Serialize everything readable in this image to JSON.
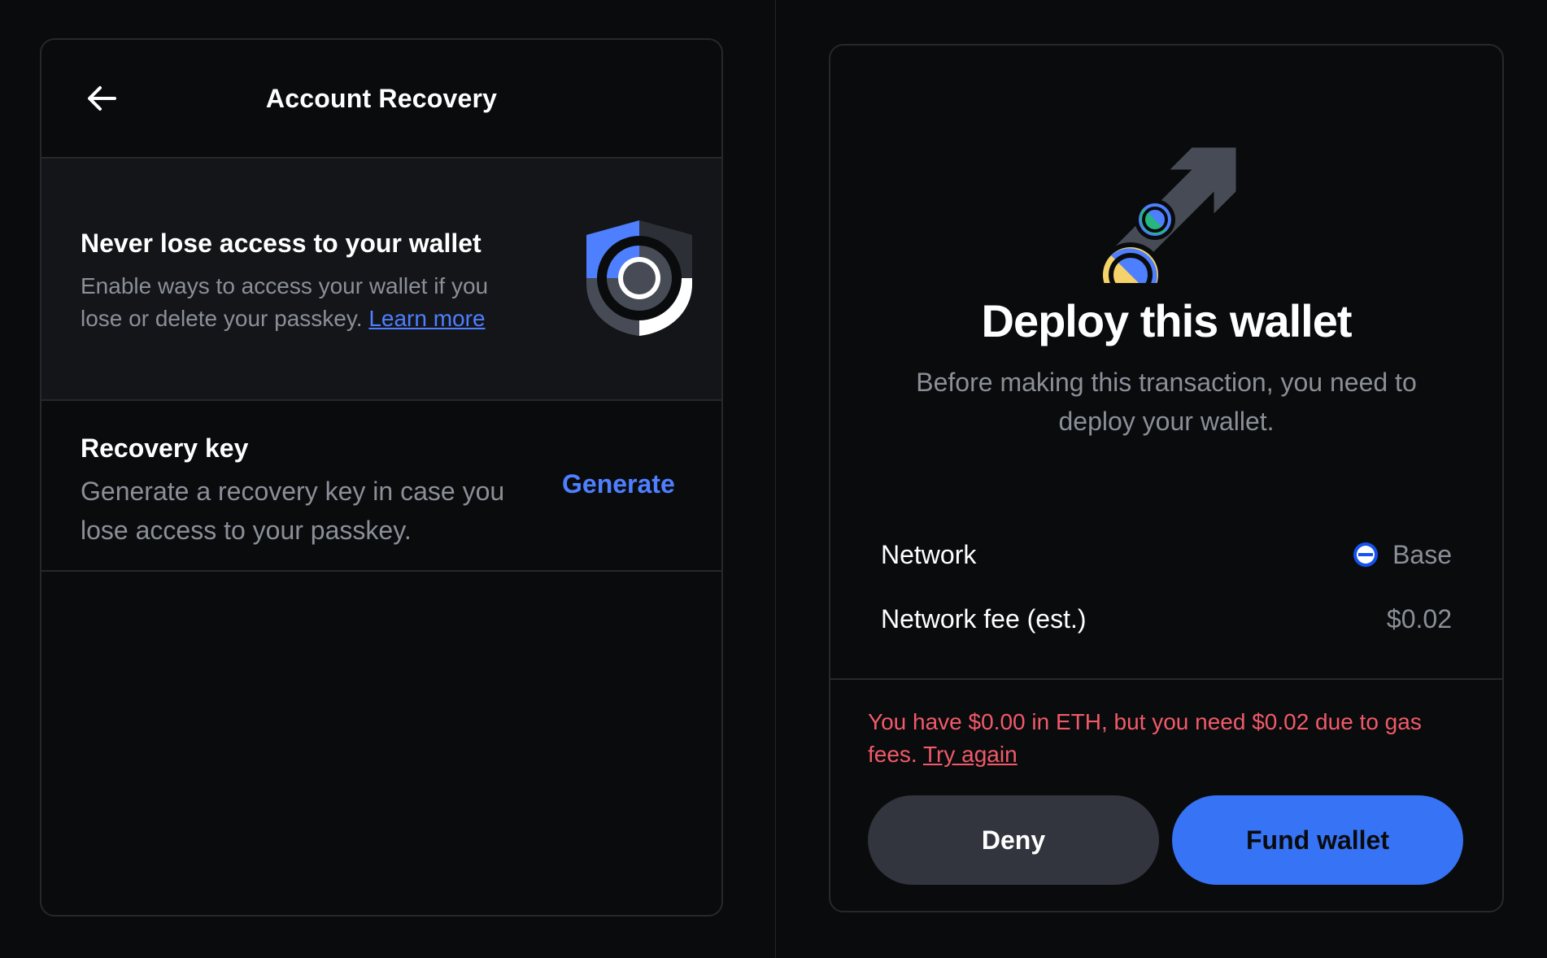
{
  "left_panel": {
    "header": {
      "title": "Account Recovery"
    },
    "hero": {
      "title": "Never lose access to your wallet",
      "description": "Enable ways to access your wallet if you lose or delete your passkey.",
      "link_label": "Learn more"
    },
    "recovery_key": {
      "title": "Recovery key",
      "description": "Generate a recovery key in case you lose access to your passkey.",
      "action_label": "Generate"
    }
  },
  "right_panel": {
    "title": "Deploy this wallet",
    "description": "Before making this transaction, you need to deploy your wallet.",
    "rows": [
      {
        "label": "Network",
        "value": "Base",
        "icon": "base-network-icon"
      },
      {
        "label": "Network fee (est.)",
        "value": "$0.02"
      }
    ],
    "error": {
      "message": "You have $0.00 in ETH, but you need $0.02 due to gas fees.",
      "link_label": "Try again"
    },
    "buttons": {
      "deny": "Deny",
      "fund": "Fund wallet"
    }
  },
  "colors": {
    "background": "#0a0b0d",
    "surface": "#141519",
    "border": "#26282d",
    "accent": "#3773f5",
    "link": "#4d7fff",
    "error": "#f05a69",
    "muted_text": "#8a8f98",
    "deny_button": "#32353d"
  }
}
